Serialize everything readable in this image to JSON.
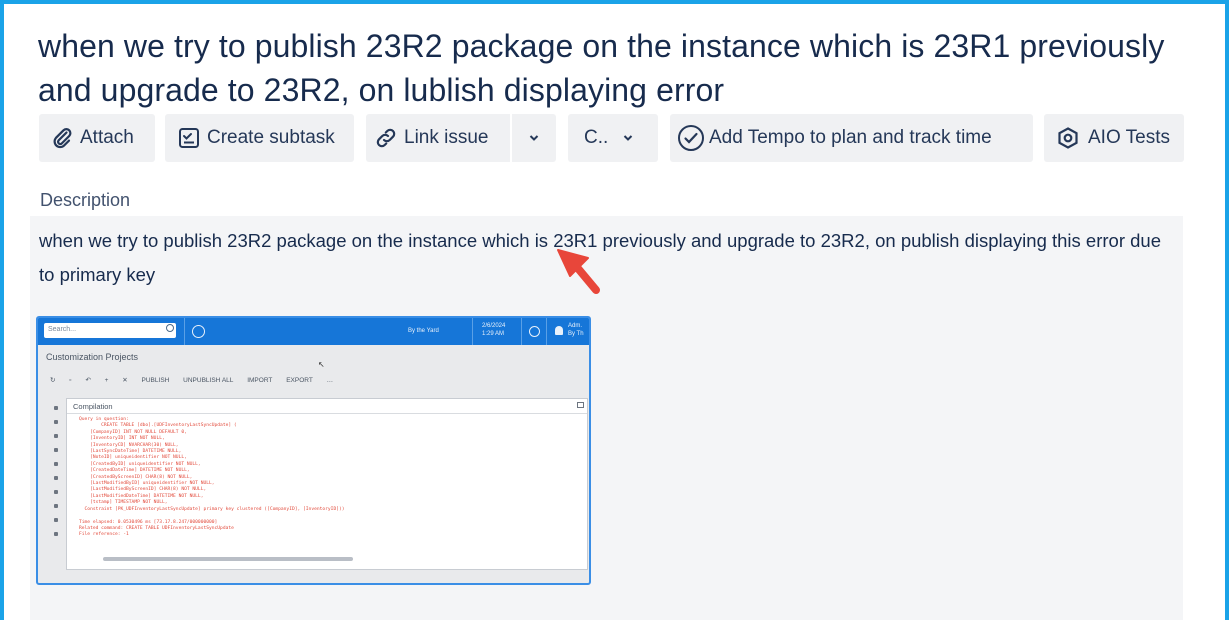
{
  "issue": {
    "title": "when we try to publish 23R2 package on the instance which is 23R1 previously and upgrade to 23R2, on lublish displaying error"
  },
  "toolbar": {
    "attach": "Attach",
    "create_subtask": "Create subtask",
    "link_issue": "Link issue",
    "c_menu": "C..",
    "add_tempo": "Add Tempo to plan and track time",
    "aio_tests": "AIO Tests"
  },
  "description": {
    "label": "Description",
    "text": "when we try to publish 23R2 package on the instance which is 23R1 previously and upgrade to 23R2, on publish displaying this error due to primary key"
  },
  "embedded_screenshot": {
    "search_placeholder": "Search...",
    "branch": "By the Yard",
    "date": "2/6/2024",
    "time": "1:29 AM",
    "user_line1": "Adm.",
    "user_line2": "By Th",
    "header": "Customization Projects",
    "menu": [
      "PUBLISH",
      "UNPUBLISH ALL",
      "IMPORT",
      "EXPORT",
      "…"
    ],
    "dialog_title": "Compilation",
    "code": "Query in question:\n        CREATE TABLE [dbo].[UDFInventoryLastSyncUpdate] (\n    [CompanyID] INT NOT NULL DEFAULT 0,\n    [InventoryID] INT NOT NULL,\n    [InventoryCD] NVARCHAR(30) NULL,\n    [LastSyncDateTime] DATETIME NULL,\n    [NoteID] uniqueidentifier NOT NULL,\n    [CreatedByID] uniqueidentifier NOT NULL,\n    [CreatedDateTime] DATETIME NOT NULL,\n    [CreatedByScreenID] CHAR(8) NOT NULL,\n    [LastModifiedByID] uniqueidentifier NOT NULL,\n    [LastModifiedByScreenID] CHAR(8) NOT NULL,\n    [LastModifiedDateTime] DATETIME NOT NULL,\n    [tstamp] TIMESTAMP NOT NULL,\n  Constraint [PK_UDFInventoryLastSyncUpdate] primary key clustered ([CompanyID], [InventoryID]))\n\nTime elapsed: 0.0530496 ms [73.17.8.247/000000000]\nRelated command: CREATE TABLE UDFInventoryLastSyncUpdate\nFile reference: -1"
  },
  "colors": {
    "frame_border": "#1aa3e8",
    "toolbar_bg": "#f0f1f3",
    "description_bg": "#f4f5f7",
    "arrow": "#e8463a",
    "app_header": "#1676d8",
    "error_text": "#e24a3b"
  },
  "icons": {
    "attach": "paperclip-icon",
    "create_subtask": "subtask-icon",
    "link_issue": "link-icon",
    "more": "chevron-down-icon",
    "add_tempo": "check-circle-icon",
    "aio_tests": "hexagon-icon",
    "annotation": "red-arrow-icon"
  }
}
